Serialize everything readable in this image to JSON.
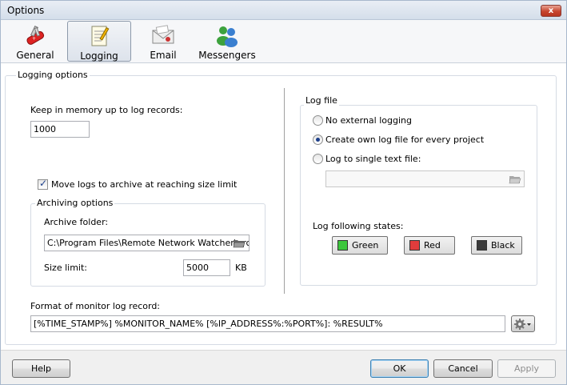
{
  "window": {
    "title": "Options",
    "close_label": "x"
  },
  "toolbar": {
    "items": [
      {
        "label": "General",
        "icon": "swiss-knife-icon"
      },
      {
        "label": "Logging",
        "icon": "notepad-icon",
        "active": true
      },
      {
        "label": "Email",
        "icon": "envelope-icon"
      },
      {
        "label": "Messengers",
        "icon": "people-icon"
      }
    ]
  },
  "logging": {
    "group_label": "Logging options",
    "memory_label": "Keep in memory up to log records:",
    "memory_value": "1000",
    "move_logs_label": "Move logs to archive at reaching size limit",
    "move_logs_checked": true,
    "archiving": {
      "group_label": "Archiving options",
      "folder_label": "Archive folder:",
      "folder_value": "C:\\Program Files\\Remote Network Watcher\\arch",
      "size_label": "Size limit:",
      "size_value": "5000",
      "size_unit": "KB"
    },
    "log_file": {
      "group_label": "Log file",
      "options": [
        {
          "label": "No external logging",
          "checked": false
        },
        {
          "label": "Create own log file for every project",
          "checked": true
        },
        {
          "label": "Log to single text file:",
          "checked": false
        }
      ],
      "single_file_value": "",
      "states_label": "Log following states:",
      "states": [
        {
          "label": "Green",
          "color": "#3cc63c"
        },
        {
          "label": "Red",
          "color": "#e03c3c"
        },
        {
          "label": "Black",
          "color": "#3a3a3a"
        }
      ]
    },
    "format_label": "Format of monitor log record:",
    "format_value": "[%TIME_STAMP%] %MONITOR_NAME% [%IP_ADDRESS%:%PORT%]: %RESULT%"
  },
  "footer": {
    "help_label": "Help",
    "ok_label": "OK",
    "cancel_label": "Cancel",
    "apply_label": "Apply"
  }
}
